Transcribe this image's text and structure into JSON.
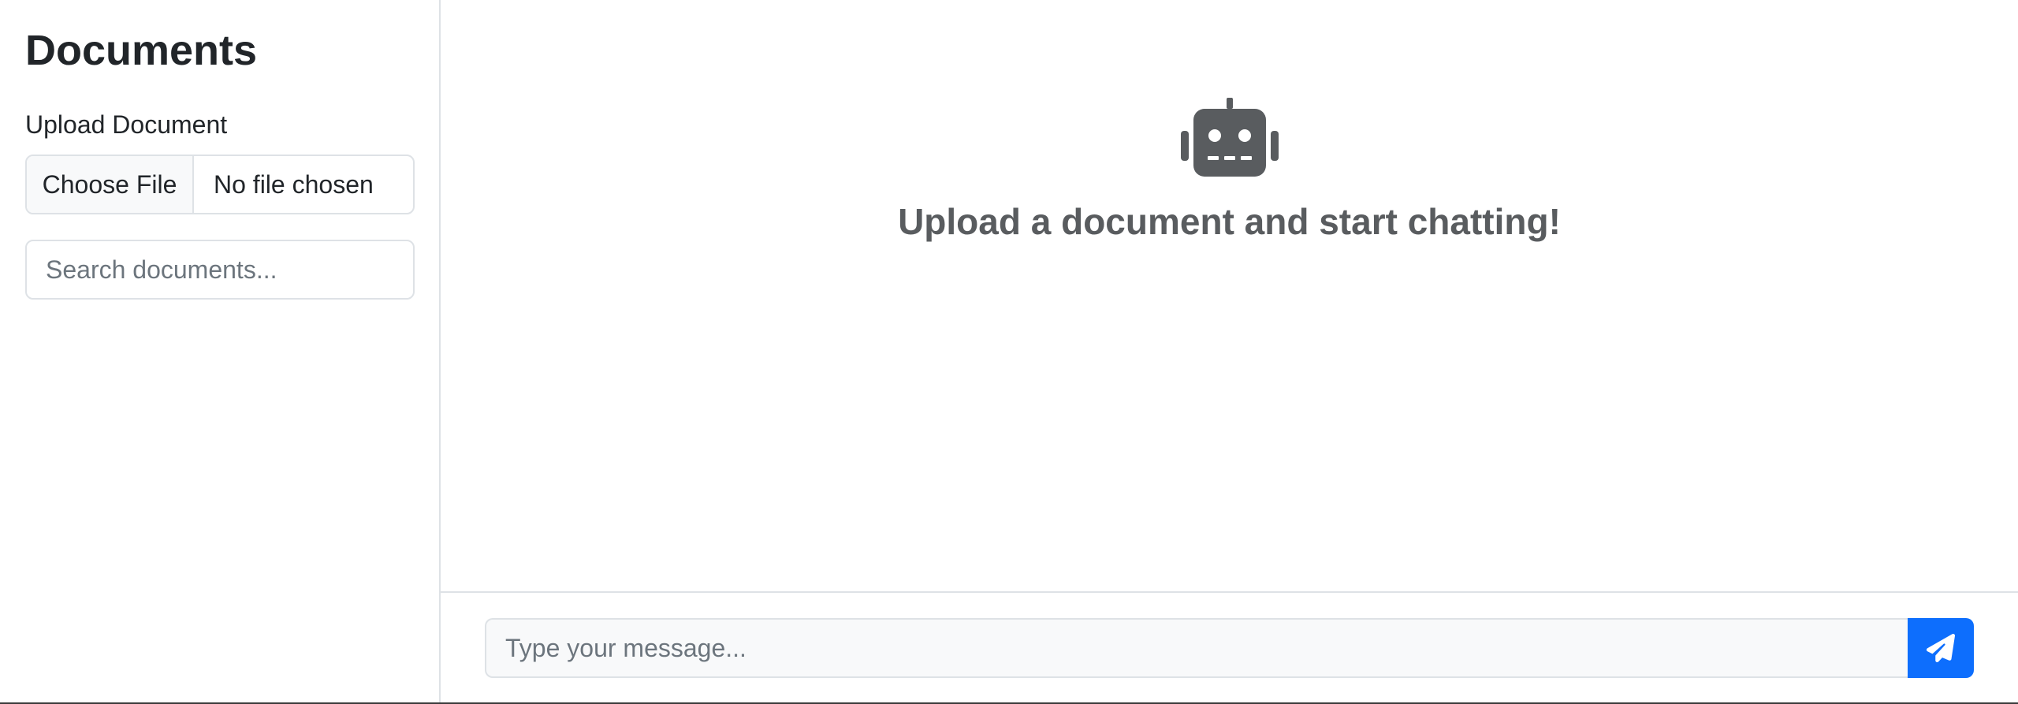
{
  "sidebar": {
    "title": "Documents",
    "upload_label": "Upload Document",
    "file_input": {
      "button_label": "Choose File",
      "status": "No file chosen"
    },
    "search": {
      "placeholder": "Search documents...",
      "value": ""
    }
  },
  "main": {
    "empty_state": {
      "icon": "robot-icon",
      "message": "Upload a document and start chatting!"
    },
    "composer": {
      "placeholder": "Type your message...",
      "value": "",
      "send_icon": "paper-plane-icon"
    }
  },
  "colors": {
    "accent": "#0d6efd",
    "icon_gray": "#595c5f",
    "border": "#dee2e6",
    "input_bg": "#f8f9fa"
  }
}
